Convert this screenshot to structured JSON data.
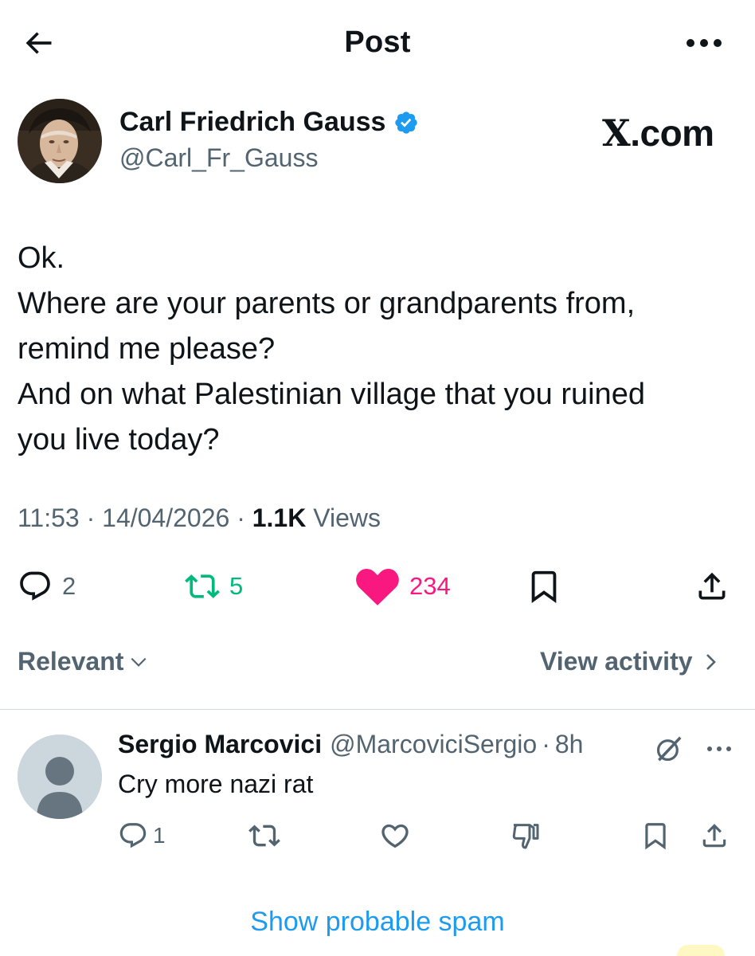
{
  "header": {
    "title": "Post"
  },
  "author": {
    "name": "Carl Friedrich Gauss",
    "handle": "@Carl_Fr_Gauss",
    "verified": true
  },
  "watermark": {
    "x": "X",
    "rest": ".com"
  },
  "post": {
    "lines": [
      "Ok.",
      "Where are your parents or grandparents from,",
      "remind me please?",
      "And on what Palestinian village that you ruined",
      "you live today?"
    ],
    "time": "11:53",
    "date": "14/04/2026",
    "views_count": "1.1K",
    "views_label": "Views",
    "sep": "·"
  },
  "actions": {
    "replies": "2",
    "reposts": "5",
    "likes": "234"
  },
  "sort": {
    "label": "Relevant",
    "view_activity": "View activity"
  },
  "reply": {
    "name": "Sergio Marcovici",
    "handle": "@MarcoviciSergio",
    "sep": "·",
    "time": "8h",
    "text": "Cry more nazi rat",
    "replies": "1"
  },
  "show_spam": "Show probable spam",
  "colors": {
    "text": "#0f1419",
    "secondary": "#536471",
    "retweet": "#00ba7c",
    "like": "#f91880",
    "link": "#1d9bf0",
    "verified": "#1d9bf0"
  }
}
